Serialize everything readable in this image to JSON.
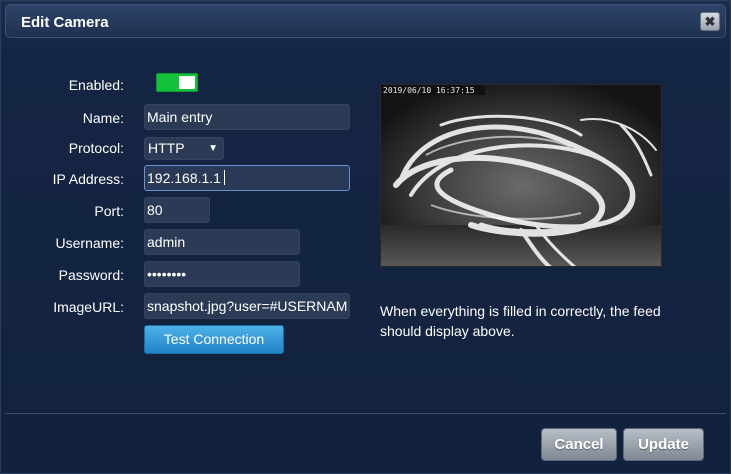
{
  "dialog": {
    "title": "Edit Camera",
    "close_glyph": "✖"
  },
  "form": {
    "enabled_label": "Enabled:",
    "enabled_on": true,
    "name_label": "Name:",
    "name_value": "Main entry",
    "protocol_label": "Protocol:",
    "protocol_value": "HTTP",
    "protocol_arrow": "▼",
    "ip_label": "IP Address:",
    "ip_value": "192.168.1.1",
    "port_label": "Port:",
    "port_value": "80",
    "username_label": "Username:",
    "username_value": "admin",
    "password_label": "Password:",
    "password_value": "••••••••",
    "imageurl_label": "ImageURL:",
    "imageurl_value": "snapshot.jpg?user=#USERNAM",
    "test_button_label": "Test Connection"
  },
  "preview": {
    "timestamp": "2019/06/10 16:37:15",
    "note": "When everything is filled in correctly, the feed should display above."
  },
  "footer": {
    "cancel_label": "Cancel",
    "update_label": "Update"
  },
  "colors": {
    "toggle_on": "#14c13a",
    "primary_button": "#2b92d6",
    "background": "#142543"
  }
}
